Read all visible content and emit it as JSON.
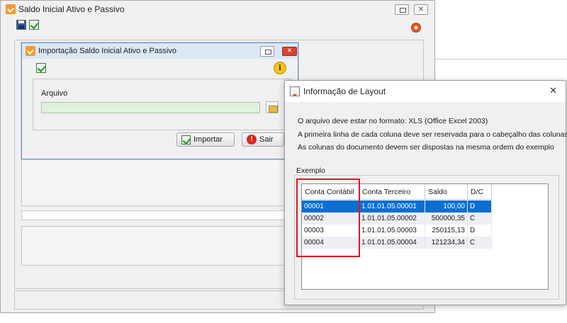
{
  "main_window": {
    "title": "Saldo Inicial Ativo e Passivo"
  },
  "import_dialog": {
    "title": "Importação Saldo Inicial Ativo e Passivo",
    "file_label": "Arquivo",
    "file_value": "",
    "import_button": "Importar",
    "exit_button": "Sair"
  },
  "layout_dialog": {
    "title": "Informação de Layout",
    "close_glyph": "✕",
    "messages": [
      "O arquivo deve estar no formato: XLS (Office Excel 2003)",
      "A primeira linha de cada coluna deve ser reservada para o cabeçalho das colunas",
      "As colunas do documento devem ser dispostas na mesma ordem do exemplo"
    ],
    "example_label": "Exemplo",
    "table": {
      "columns": [
        "Conta Contábil",
        "Conta Terceiro",
        "Saldo",
        "D/C"
      ],
      "rows": [
        [
          "00001",
          "1.01.01.05.00001",
          "100,00",
          "D"
        ],
        [
          "00002",
          "1.01.01.05.00002",
          "500000,35",
          "C"
        ],
        [
          "00003",
          "1.01.01.05.00003",
          "250115,13",
          "D"
        ],
        [
          "00004",
          "1.01.01.05.00004",
          "121234,34",
          "C"
        ]
      ],
      "selected_row": 0
    }
  },
  "colors": {
    "selection": "#0b6fd1",
    "highlight_box": "#e0161c",
    "app_icon": "#f39a2c"
  }
}
